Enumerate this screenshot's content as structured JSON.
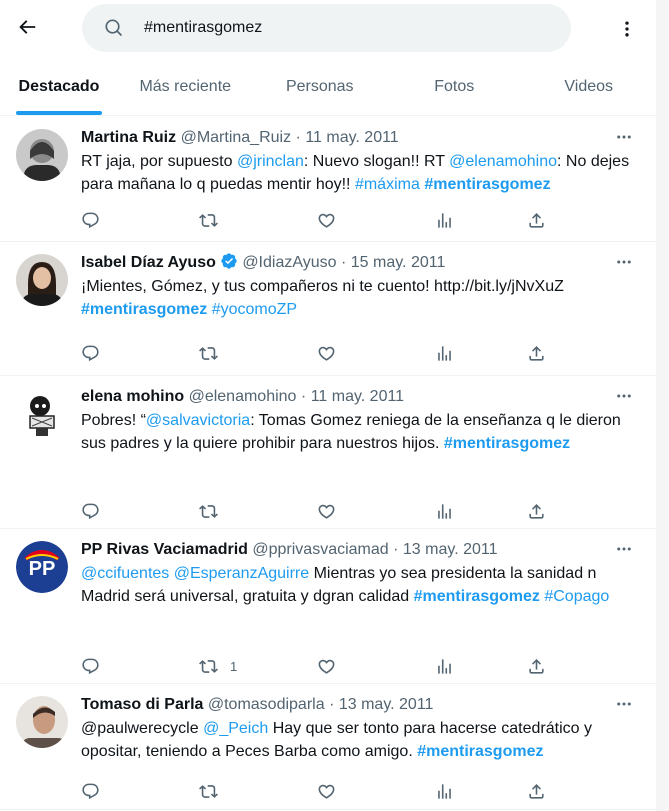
{
  "header": {
    "search_value": "#mentirasgomez",
    "back_icon": "arrow-left-icon",
    "more_icon": "more-vertical-icon"
  },
  "tabs": [
    {
      "label": "Destacado",
      "active": true
    },
    {
      "label": "Más reciente",
      "active": false
    },
    {
      "label": "Personas",
      "active": false
    },
    {
      "label": "Fotos",
      "active": false
    },
    {
      "label": "Videos",
      "active": false
    }
  ],
  "colors": {
    "accent": "#1d9bf0",
    "muted": "#536471",
    "text": "#0f1419"
  },
  "tweets": [
    {
      "name": "Martina Ruiz",
      "handle": "@Martina_Ruiz",
      "sep": "·",
      "date": "11 may. 2011",
      "verified": false,
      "parts": [
        {
          "t": "RT jaja, por supuesto "
        },
        {
          "t": "@jrinclan",
          "c": "link"
        },
        {
          "t": ": Nuevo slogan!! RT "
        },
        {
          "t": "@elenamohino",
          "c": "link"
        },
        {
          "t": ": No dejes para mañana lo q puedas mentir hoy!! "
        },
        {
          "t": "#máxima",
          "c": "hashtag"
        },
        {
          "t": " "
        },
        {
          "t": "#mentirasgomez",
          "c": "hashtag bold"
        }
      ],
      "retweet_count": "",
      "avatar": "woman-gray-avatar"
    },
    {
      "name": "Isabel Díaz Ayuso",
      "handle": "@IdiazAyuso",
      "sep": "·",
      "date": "15 may. 2011",
      "verified": true,
      "parts": [
        {
          "t": "¡Mientes, Gómez, y tus compañeros ni te cuento! http://bit.ly/jNvXuZ"
        },
        {
          "t": "\n"
        },
        {
          "t": "#mentirasgomez",
          "c": "hashtag bold"
        },
        {
          "t": " "
        },
        {
          "t": "#yocomoZP",
          "c": "hashtag"
        }
      ],
      "retweet_count": "",
      "avatar": "woman-dark-hair-avatar"
    },
    {
      "name": "elena mohino",
      "handle": "@elenamohino",
      "sep": "·",
      "date": "11 may. 2011",
      "verified": false,
      "parts": [
        {
          "t": "Pobres! “"
        },
        {
          "t": "@salvavictoria",
          "c": "link"
        },
        {
          "t": ": Tomas Gomez reniega de la enseñanza q le dieron sus padres y la quiere prohibir para nuestros hijos. "
        },
        {
          "t": "#mentirasgomez",
          "c": "hashtag bold"
        }
      ],
      "retweet_count": "",
      "avatar": "cartoon-avatar"
    },
    {
      "name": "PP Rivas Vaciamadrid",
      "handle": "@pprivasvaciamad",
      "sep": "·",
      "date": "13 may. 2011",
      "verified": false,
      "parts": [
        {
          "t": "@ccifuentes",
          "c": "link"
        },
        {
          "t": " "
        },
        {
          "t": "@EsperanzAguirre",
          "c": "link"
        },
        {
          "t": " Mientras yo sea presidenta la sanidad n Madrid será universal, gratuita y dgran calidad "
        },
        {
          "t": "#mentirasgomez",
          "c": "hashtag bold"
        },
        {
          "t": " "
        },
        {
          "t": "#Copago",
          "c": "hashtag"
        }
      ],
      "retweet_count": "1",
      "avatar": "pp-logo-avatar",
      "avatar_text": "PP"
    },
    {
      "name": "Tomaso di Parla",
      "handle": "@tomasodiparla",
      "sep": "·",
      "date": "13 may. 2011",
      "verified": false,
      "parts": [
        {
          "t": "@paulwerecycle",
          "c": "plain"
        },
        {
          "t": " "
        },
        {
          "t": "@_Peich",
          "c": "link"
        },
        {
          "t": " Hay que ser tonto para hacerse catedrático y opositar, teniendo a Peces Barba como amigo. "
        },
        {
          "t": "#mentirasgomez",
          "c": "hashtag bold"
        }
      ],
      "retweet_count": "",
      "avatar": "man-avatar"
    }
  ]
}
